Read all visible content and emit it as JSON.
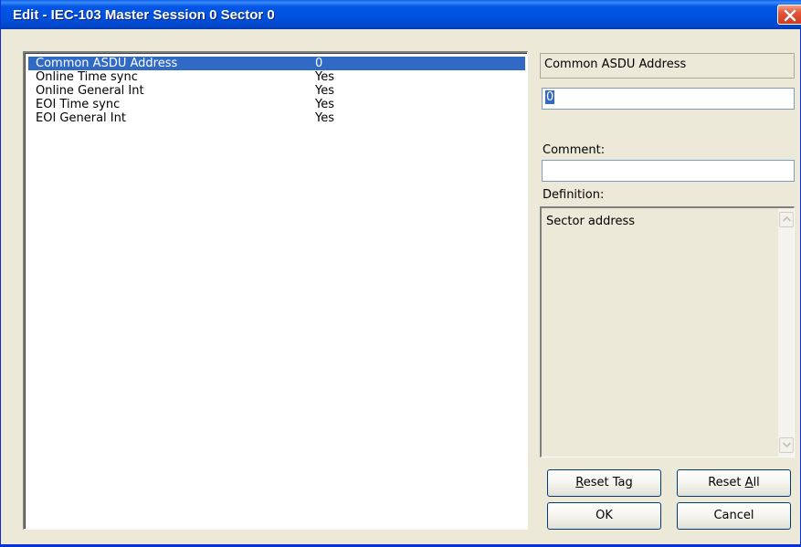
{
  "window": {
    "title": "Edit - IEC-103 Master Session 0 Sector 0"
  },
  "parameters": [
    {
      "name": "Common ASDU Address",
      "value": "0",
      "selected": true
    },
    {
      "name": "Online Time sync",
      "value": "Yes",
      "selected": false
    },
    {
      "name": "Online General Int",
      "value": "Yes",
      "selected": false
    },
    {
      "name": "EOI Time sync",
      "value": "Yes",
      "selected": false
    },
    {
      "name": "EOI General Int",
      "value": "Yes",
      "selected": false
    }
  ],
  "editor": {
    "field_title": "Common ASDU Address",
    "value": "0",
    "comment_label": "Comment:",
    "comment_value": "",
    "definition_label": "Definition:",
    "definition_text": "Sector address"
  },
  "buttons": {
    "reset_tag_pre": "",
    "reset_tag_mn": "R",
    "reset_tag_post": "eset Tag",
    "reset_all_pre": "Reset ",
    "reset_all_mn": "A",
    "reset_all_post": "ll",
    "ok": "OK",
    "cancel": "Cancel"
  },
  "colors": {
    "titlebar": "#0052df",
    "selection": "#316ac5",
    "dialog_bg": "#ece9d8",
    "close_button": "#e3543a"
  },
  "icons": {
    "close": "close-x-icon",
    "scroll_up": "scroll-up-arrow-icon",
    "scroll_down": "scroll-down-arrow-icon"
  }
}
